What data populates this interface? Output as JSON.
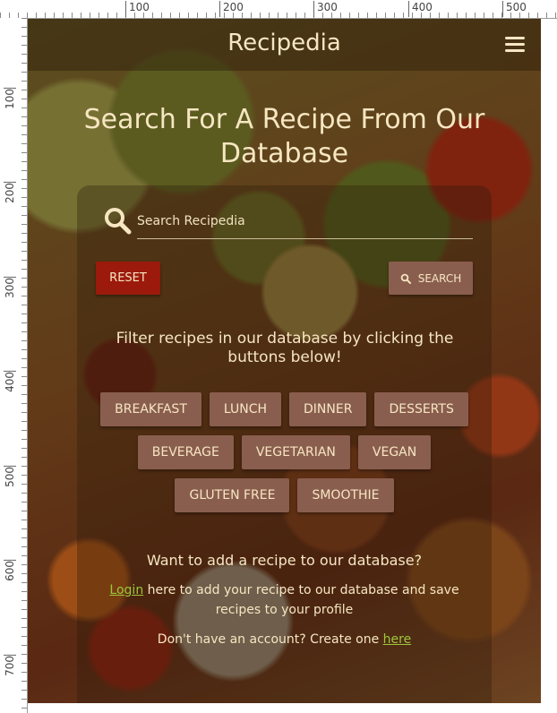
{
  "ruler": {
    "top_labels": [
      "100",
      "200",
      "300",
      "400",
      "500"
    ],
    "left_labels": [
      "100",
      "200",
      "300",
      "400",
      "500",
      "600",
      "700"
    ]
  },
  "navbar": {
    "brand": "Recipedia",
    "menu_icon": "hamburger-menu-icon"
  },
  "page": {
    "title": "Search For A Recipe From Our Database"
  },
  "search": {
    "placeholder": "Search Recipedia",
    "icon": "search-icon",
    "reset_label": "RESET",
    "search_label": "SEARCH"
  },
  "filters": {
    "instructions": "Filter recipes in our database by clicking the buttons below!",
    "rows": [
      [
        "BREAKFAST",
        "LUNCH",
        "DINNER",
        "DESSERTS"
      ],
      [
        "BEVERAGE",
        "VEGETARIAN",
        "VEGAN"
      ],
      [
        "GLUTEN FREE",
        "SMOOTHIE"
      ]
    ]
  },
  "add_recipe": {
    "heading": "Want to add a recipe to our database?",
    "login_link": "Login",
    "login_text": " here to add your recipe to our database and save recipes to your profile",
    "signup_text": "Don't have an account? Create one ",
    "signup_link": "here"
  },
  "colors": {
    "text": "#f6e6c2",
    "reset_button": "#9c1a0c",
    "filter_button": "#8a5e4e",
    "link": "#9dc63a"
  }
}
